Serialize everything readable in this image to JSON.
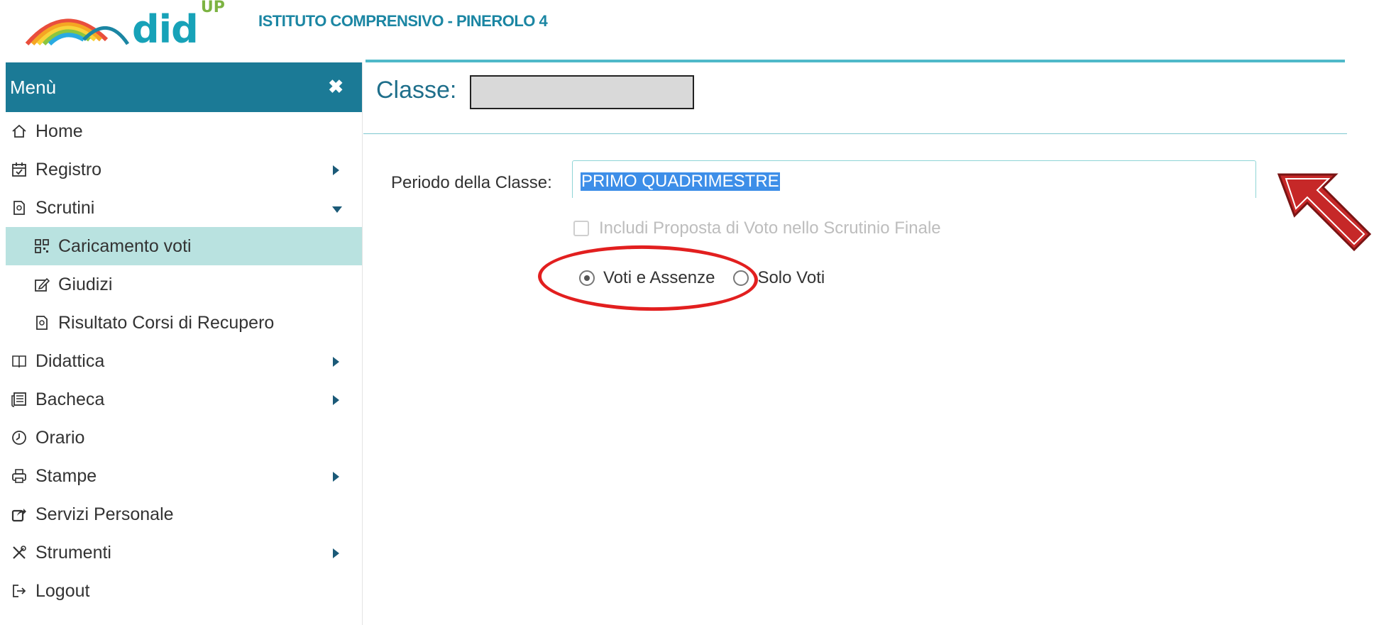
{
  "header": {
    "brand": "did",
    "brand_sup": "UP",
    "school": "ISTITUTO COMPRENSIVO - PINEROLO 4"
  },
  "sidebar": {
    "title": "Menù",
    "close_icon": "close-icon",
    "items": [
      {
        "label": "Home",
        "icon": "home-icon"
      },
      {
        "label": "Registro",
        "icon": "calendar-icon"
      },
      {
        "label": "Scrutini",
        "icon": "scrutini-icon"
      },
      {
        "label": "Caricamento voti",
        "icon": "qrcode-icon"
      },
      {
        "label": "Giudizi",
        "icon": "edit-icon"
      },
      {
        "label": "Risultato Corsi di Recupero",
        "icon": "scrutini-icon"
      },
      {
        "label": "Didattica",
        "icon": "book-icon"
      },
      {
        "label": "Bacheca",
        "icon": "newspaper-icon"
      },
      {
        "label": "Orario",
        "icon": "clock-icon"
      },
      {
        "label": "Stampe",
        "icon": "printer-icon"
      },
      {
        "label": "Servizi Personale",
        "icon": "share-icon"
      },
      {
        "label": "Strumenti",
        "icon": "tools-icon"
      },
      {
        "label": "Logout",
        "icon": "logout-icon"
      }
    ]
  },
  "main": {
    "title": "Classe:",
    "period_label": "Periodo della Classe:",
    "period_value": "PRIMO QUADRIMESTRE",
    "checkbox_label": "Includi Proposta di Voto nello Scrutinio Finale",
    "radio1_label": "Voti e Assenze",
    "radio2_label": "Solo Voti",
    "radio_selected": "Voti e Assenze"
  },
  "colors": {
    "teal_header": "#1b7a96",
    "active_bg": "#b9e2e0",
    "accent_line": "#4fb9c9",
    "highlight": "#3d8ee8",
    "annotation": "#e21f1f"
  }
}
